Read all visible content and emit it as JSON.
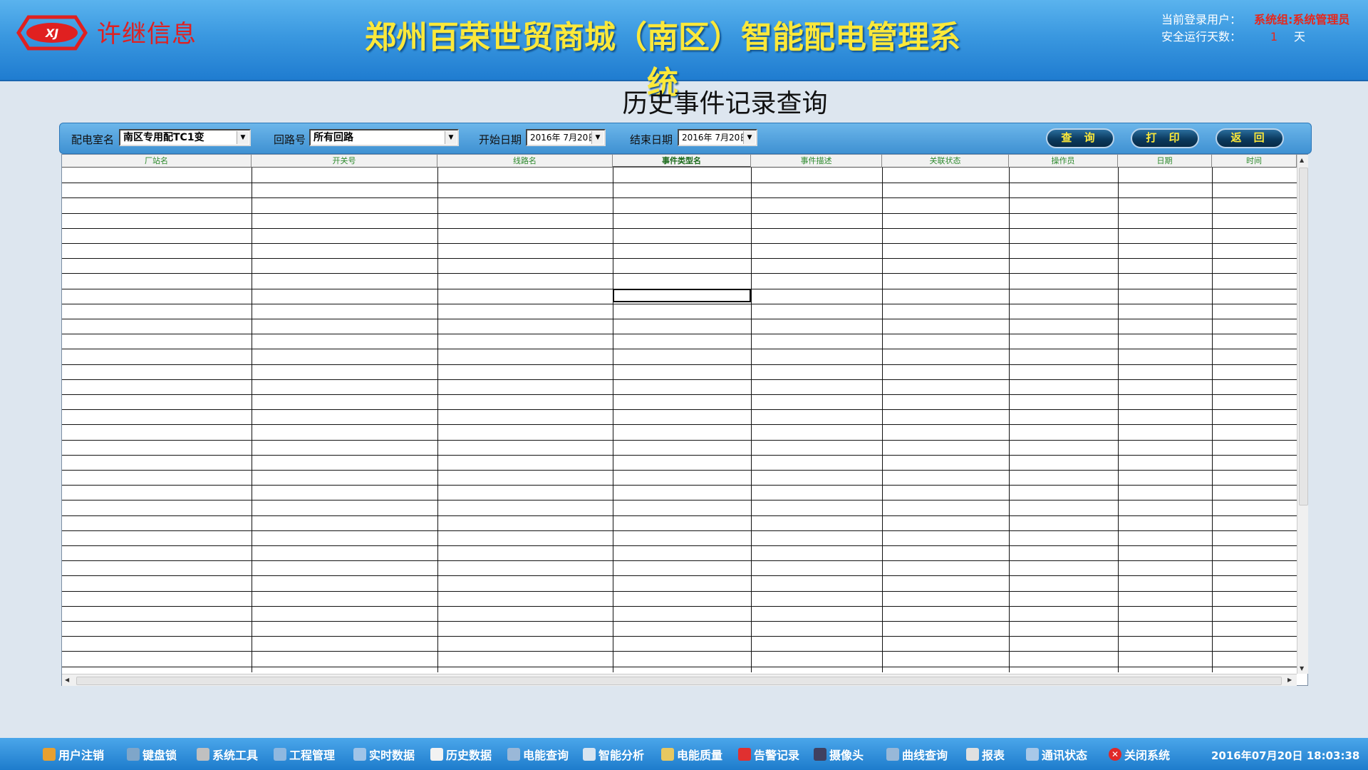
{
  "header": {
    "logo_text": "许继信息",
    "system_title": "郑州百荣世贸商城（南区）智能配电管理系统",
    "user_label": "当前登录用户：",
    "user_value": "系统组:系统管理员",
    "days_label": "安全运行天数：",
    "days_value": "1",
    "days_unit": "天"
  },
  "page": {
    "title": "历史事件记录查询"
  },
  "filters": {
    "room_label": "配电室名",
    "room_value": "南区专用配TC1变",
    "loop_label": "回路号",
    "loop_value": "所有回路",
    "start_label": "开始日期",
    "start_value": "2016年 7月20日",
    "end_label": "结束日期",
    "end_value": "2016年 7月20日"
  },
  "buttons": {
    "query": "查 询",
    "print": "打 印",
    "back": "返 回"
  },
  "table": {
    "columns": [
      "厂站名",
      "开关号",
      "线路名",
      "事件类型名",
      "事件描述",
      "关联状态",
      "操作员",
      "日期",
      "时间"
    ],
    "rows": []
  },
  "taskbar": {
    "items": [
      {
        "label": "用户注销",
        "icon": "users-icon",
        "color": "#e8a030"
      },
      {
        "label": "键盘锁",
        "icon": "keyboard-icon",
        "color": "#7fa6c9"
      },
      {
        "label": "系统工具",
        "icon": "tools-icon",
        "color": "#c0c0c0"
      },
      {
        "label": "工程管理",
        "icon": "project-icon",
        "color": "#8fb8e0"
      },
      {
        "label": "实时数据",
        "icon": "realtime-icon",
        "color": "#a0c4e8"
      },
      {
        "label": "历史数据",
        "icon": "history-icon",
        "color": "#f2f2f2"
      },
      {
        "label": "电能查询",
        "icon": "energy-icon",
        "color": "#9ab8d8"
      },
      {
        "label": "智能分析",
        "icon": "analysis-icon",
        "color": "#d8e4f0"
      },
      {
        "label": "电能质量",
        "icon": "quality-icon",
        "color": "#e8c860"
      },
      {
        "label": "告警记录",
        "icon": "alarm-icon",
        "color": "#e03030"
      },
      {
        "label": "摄像头",
        "icon": "camera-icon",
        "color": "#404060"
      },
      {
        "label": "曲线查询",
        "icon": "curve-icon",
        "color": "#98b8d8"
      },
      {
        "label": "报表",
        "icon": "report-icon",
        "color": "#e0e0e0"
      },
      {
        "label": "通讯状态",
        "icon": "network-icon",
        "color": "#a8c8e8"
      },
      {
        "label": "关闭系统",
        "icon": "close-icon",
        "color": "#e02828"
      }
    ],
    "clock": "2016年07月20日 18:03:38"
  }
}
